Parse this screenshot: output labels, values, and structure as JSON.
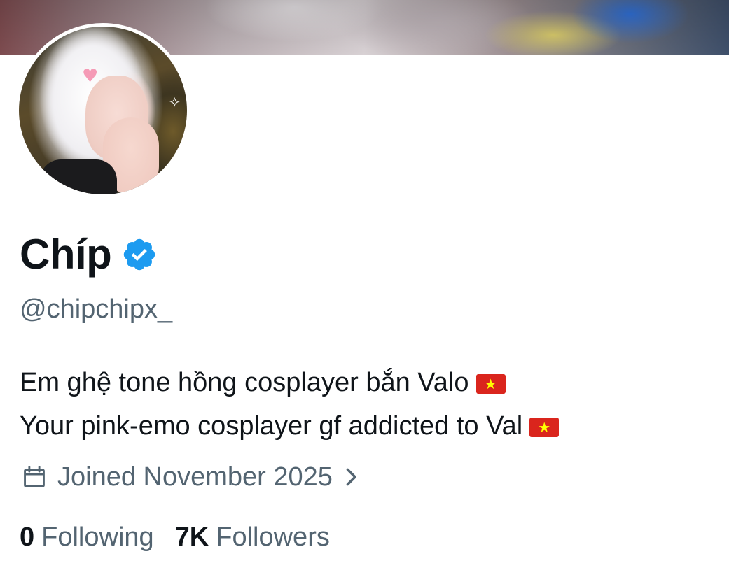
{
  "profile": {
    "display_name": "Chíp",
    "verified_icon": "verified-badge-icon",
    "handle": "@chipchipx_",
    "bio_lines": [
      {
        "text": "Em ghệ tone hồng cosplayer bắn Valo",
        "flag": "vietnam-flag-icon"
      },
      {
        "text": "Your pink-emo cosplayer gf addicted to Val",
        "flag": "vietnam-flag-icon"
      }
    ],
    "joined": {
      "icon": "calendar-icon",
      "text": "Joined November 2025",
      "chevron": "chevron-right-icon"
    },
    "stats": {
      "following_count": "0",
      "following_label": "Following",
      "followers_count": "7K",
      "followers_label": "Followers"
    }
  },
  "colors": {
    "text_primary": "#0f1419",
    "text_secondary": "#536471",
    "verified_blue": "#1d9bf0",
    "background": "#ffffff",
    "flag_red": "#da251d",
    "flag_star": "#ffff00"
  }
}
